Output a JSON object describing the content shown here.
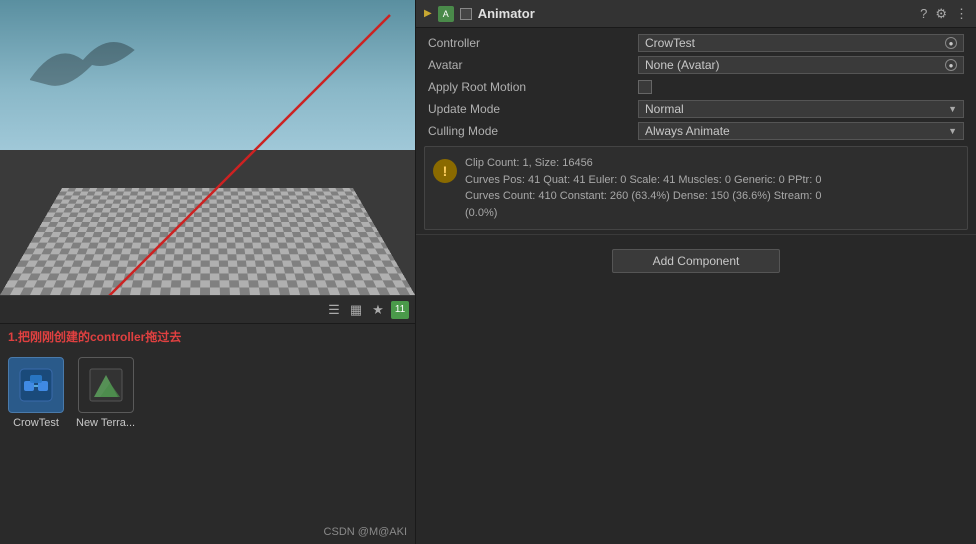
{
  "left_panel": {
    "instruction": "1.把刚刚创建的controller拖过去",
    "toolbar": {
      "badge_count": "11"
    },
    "files": [
      {
        "name": "CrowTest",
        "type": "crowtest"
      },
      {
        "name": "New Terra...",
        "type": "terrain"
      }
    ],
    "watermark": "CSDN @M@AKI"
  },
  "inspector": {
    "title": "Animator",
    "fields": {
      "controller_label": "Controller",
      "controller_value": "CrowTest",
      "avatar_label": "Avatar",
      "avatar_value": "None (Avatar)",
      "apply_root_motion_label": "Apply Root Motion",
      "update_mode_label": "Update Mode",
      "update_mode_value": "Normal",
      "culling_mode_label": "Culling Mode",
      "culling_mode_value": "Always Animate"
    },
    "warning": {
      "line1": "Clip Count: 1, Size: 16456",
      "line2": "Curves Pos: 41 Quat: 41 Euler: 0 Scale: 41 Muscles: 0 Generic: 0 PPtr: 0",
      "line3": "Curves Count: 410 Constant: 260 (63.4%) Dense: 150 (36.6%) Stream: 0",
      "line4": "(0.0%)"
    },
    "add_component_label": "Add Component"
  }
}
